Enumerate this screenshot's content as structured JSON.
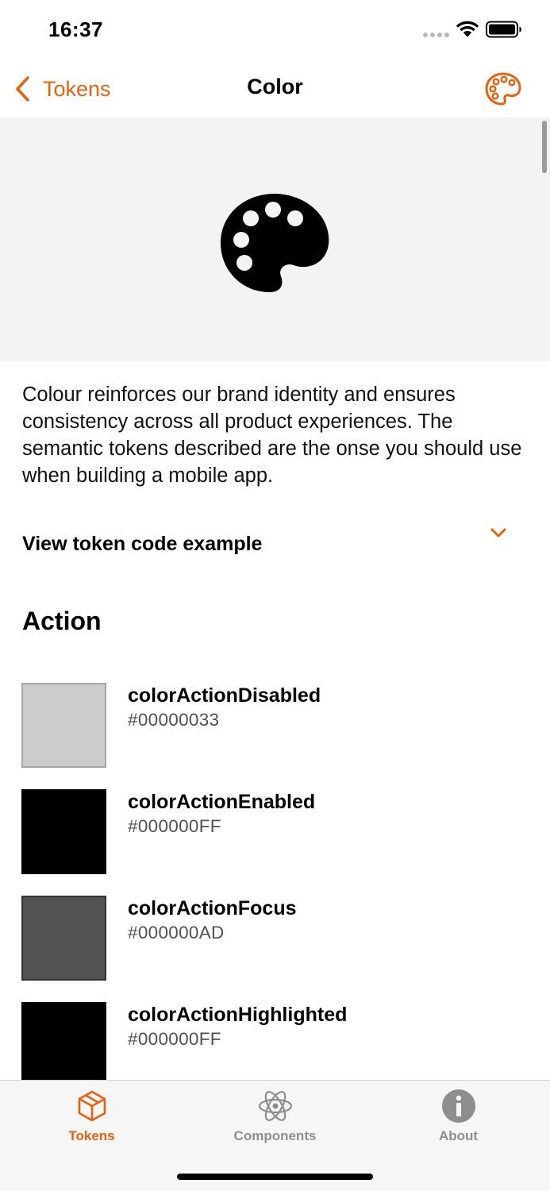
{
  "status_bar": {
    "time": "16:37"
  },
  "nav": {
    "back_label": "Tokens",
    "title": "Color",
    "action_icon": "palette-icon"
  },
  "hero": {
    "icon": "palette-icon"
  },
  "description": "Colour reinforces our brand identity and ensures consistency across all product experiences. The semantic tokens described are the onse you should use when building a mobile app.",
  "code_toggle": {
    "label": "View token code example",
    "icon": "chevron-down-icon"
  },
  "section": {
    "title": "Action"
  },
  "tokens": [
    {
      "name": "colorActionDisabled",
      "value": "#00000033",
      "swatch_color": "#cccccc",
      "border_color": "#a5a5a5"
    },
    {
      "name": "colorActionEnabled",
      "value": "#000000FF",
      "swatch_color": "#000000",
      "border_color": "#000000"
    },
    {
      "name": "colorActionFocus",
      "value": "#000000AD",
      "swatch_color": "#525252",
      "border_color": "#333333"
    },
    {
      "name": "colorActionHighlighted",
      "value": "#000000FF",
      "swatch_color": "#000000",
      "border_color": "#000000"
    }
  ],
  "tab_bar": {
    "tabs": [
      {
        "label": "Tokens",
        "icon": "cube-icon",
        "active": true
      },
      {
        "label": "Components",
        "icon": "atom-icon",
        "active": false
      },
      {
        "label": "About",
        "icon": "info-icon",
        "active": false
      }
    ]
  },
  "colors": {
    "accent": "#e8620e",
    "hero_background": "#f3f3f3",
    "tab_inactive": "#8e8e8e"
  }
}
